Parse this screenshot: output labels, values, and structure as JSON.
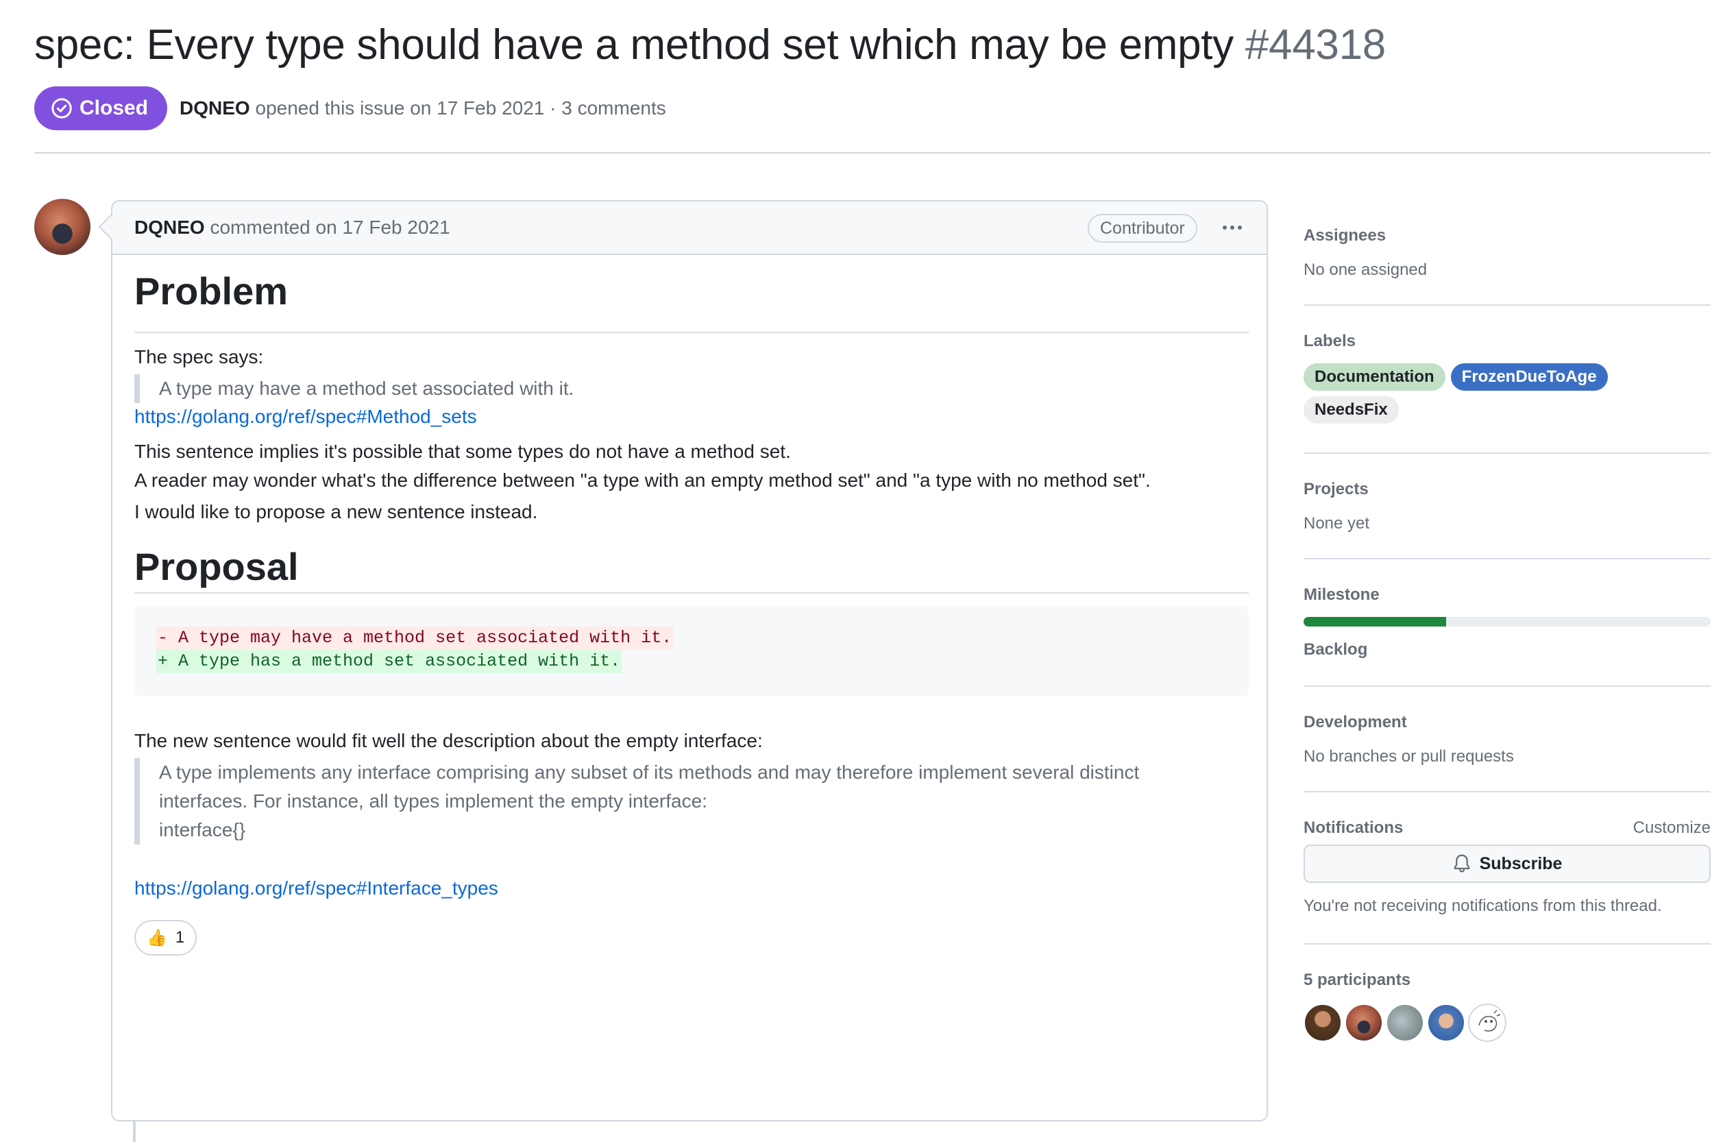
{
  "issue": {
    "title": "spec: Every type should have a method set which may be empty",
    "number": "#44318",
    "state": "Closed",
    "author": "DQNEO",
    "opened_text": "opened this issue on 17 Feb 2021 · 3 comments",
    "colors": {
      "closed": "#8250df",
      "link": "#0969da"
    }
  },
  "comment": {
    "author": "DQNEO",
    "date_text": "commented on 17 Feb 2021",
    "role_badge": "Contributor",
    "menu_icon": "kebab-horizontal-icon",
    "problem_heading": "Problem",
    "spec_says": "The spec says:",
    "quote1": "A type may have a method set associated with it.",
    "link1": "https://golang.org/ref/spec#Method_sets",
    "para1_line1": "This sentence implies it's possible that some types do not have a method set.",
    "para1_line2": "A reader may wonder what's the difference between \"a type with an empty method set\" and \"a type with no method set\".",
    "para2": "I would like to propose a new sentence instead.",
    "proposal_heading": "Proposal",
    "diff_removed": "- A type may have a method set associated with it.",
    "diff_added": "+ A type has a method set associated with it.",
    "para3": "The new sentence would fit well the description about the empty interface:",
    "quote2_line1": "A type implements any interface comprising any subset of its methods and may therefore implement several distinct",
    "quote2_line2": "interfaces. For instance, all types implement the empty interface:",
    "quote2_line3": "interface{}",
    "link2": "https://golang.org/ref/spec#Interface_types",
    "reaction": {
      "emoji": "👍",
      "icon": "thumbs-up-icon",
      "count": "1"
    }
  },
  "sidebar": {
    "assignees": {
      "title": "Assignees",
      "value": "No one assigned"
    },
    "labels": {
      "title": "Labels",
      "items": [
        {
          "text": "Documentation",
          "bg": "#c2e0c6",
          "fg": "#1f2328"
        },
        {
          "text": "FrozenDueToAge",
          "bg": "#3a6fc4",
          "fg": "#ffffff"
        },
        {
          "text": "NeedsFix",
          "bg": "#ededed",
          "fg": "#1f2328"
        }
      ]
    },
    "projects": {
      "title": "Projects",
      "value": "None yet"
    },
    "milestone": {
      "title": "Milestone",
      "name": "Backlog",
      "progress": 0.35,
      "color": "#1f883d"
    },
    "development": {
      "title": "Development",
      "value": "No branches or pull requests"
    },
    "notifications": {
      "title": "Notifications",
      "customize": "Customize",
      "subscribe": "Subscribe",
      "subscribe_icon": "bell-icon",
      "note": "You're not receiving notifications from this thread."
    },
    "participants": {
      "title": "5 participants",
      "count": 5
    }
  }
}
